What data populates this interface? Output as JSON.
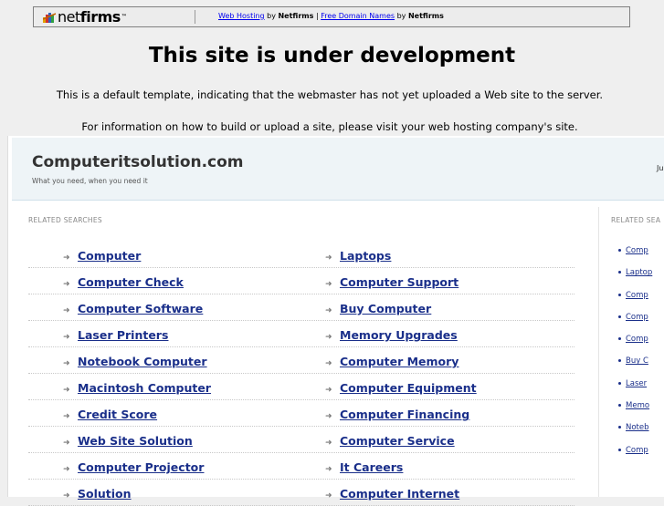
{
  "topbar": {
    "logo_net": "net",
    "logo_firms": "firms",
    "link1": "Web Hosting",
    "by1": " by ",
    "brand1": "Netfirms",
    "sep": " | ",
    "link2": "Free Domain Names",
    "by2": " by ",
    "brand2": "Netfirms"
  },
  "notice": {
    "title": "This site is under development",
    "line1": "This is a default template, indicating that the webmaster has not yet uploaded a Web site to the server.",
    "line2": "For information on how to build or upload a site, please visit your web hosting company's site."
  },
  "parked": {
    "site_name": "Computeritsolution.com",
    "tagline": "What you need, when you need it",
    "header_right": "Ju",
    "related_label": "RELATED SEARCHES",
    "side_label": "RELATED SEA",
    "left_col": [
      "Computer",
      "Computer Check",
      "Computer Software",
      "Laser Printers",
      "Notebook Computer",
      "Macintosh Computer",
      "Credit Score",
      "Web Site Solution",
      "Computer Projector",
      "Solution"
    ],
    "right_col": [
      "Laptops",
      "Computer Support",
      "Buy Computer",
      "Memory Upgrades",
      "Computer Memory",
      "Computer Equipment",
      "Computer Financing",
      "Computer Service",
      "It Careers",
      "Computer Internet"
    ],
    "side_items": [
      "Comp",
      "Laptop",
      "Comp",
      "Comp",
      "Comp",
      "Buy C",
      "Laser",
      "Memo",
      "Noteb",
      "Comp"
    ]
  }
}
